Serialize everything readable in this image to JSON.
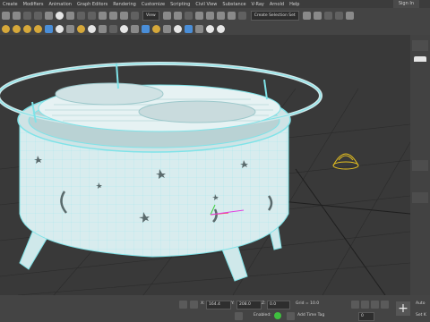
{
  "menu": {
    "items": [
      "Create",
      "Modifiers",
      "Animation",
      "Graph Editors",
      "Rendering",
      "Customize",
      "Scripting",
      "Civil View",
      "Substance",
      "V-Ray",
      "Arnold",
      "Help"
    ],
    "sign_in": "Sign In"
  },
  "toolbar": {
    "view_dropdown": "View",
    "selection_set_dropdown": "Create Selection Set"
  },
  "status": {
    "x_label": "X:",
    "x_value": "164.4",
    "y_label": "Y:",
    "y_value": "208.0",
    "z_label": "Z:",
    "z_value": "0.0",
    "grid_label": "Grid = 10.0",
    "enabled_label": "Enabled:",
    "add_time_tag": "Add Time Tag",
    "auto_label": "Auto",
    "set_key_label": "Set K",
    "frame_value": "0"
  },
  "colors": {
    "mesh": "#7fe3e8",
    "viewport_bg": "#393939",
    "gizmo": "#e6c020"
  }
}
